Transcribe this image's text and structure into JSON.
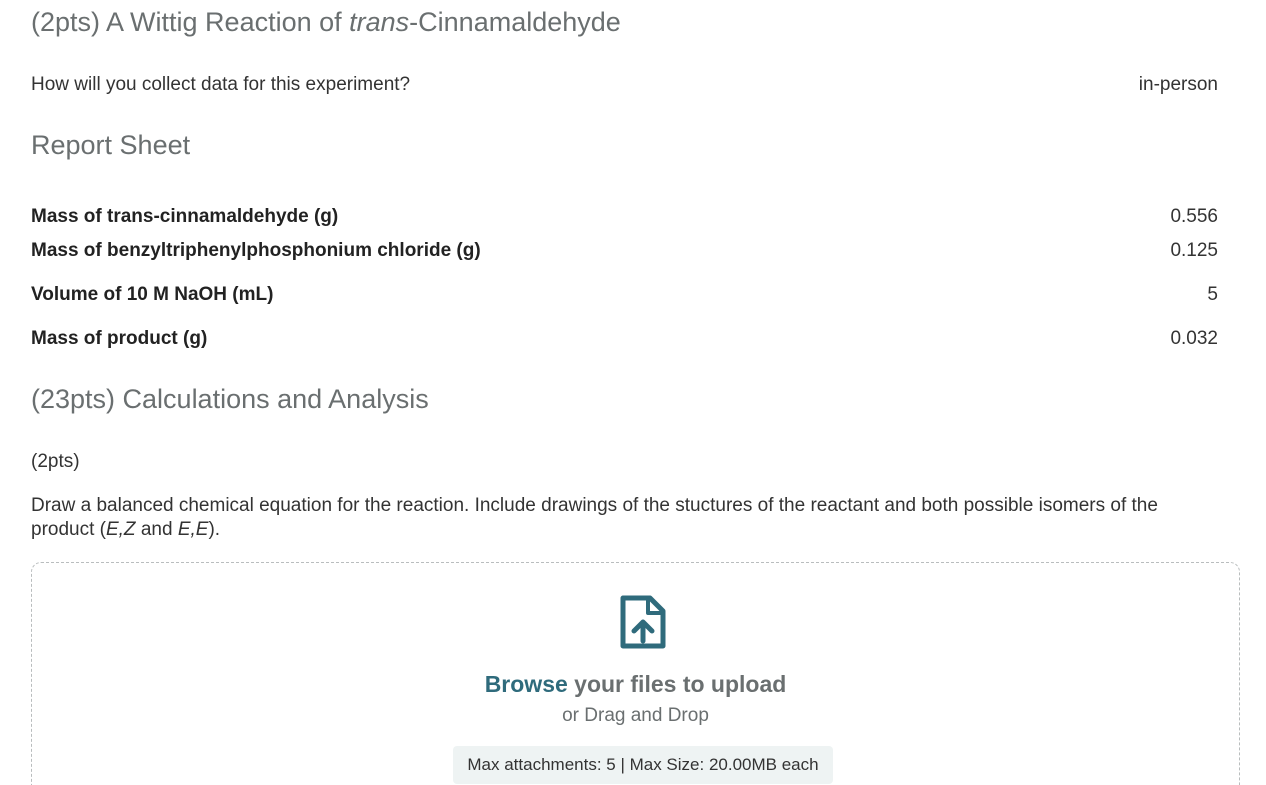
{
  "header": {
    "title_prefix": "(2pts) A Wittig Reaction of ",
    "title_italic": "trans",
    "title_suffix": "-Cinnamaldehyde"
  },
  "collection": {
    "question": "How will you collect data for this experiment?",
    "answer": "in-person"
  },
  "report_sheet": {
    "title": "Report Sheet",
    "rows": [
      {
        "label": "Mass of trans-cinnamaldehyde (g)",
        "value": "0.556"
      },
      {
        "label": "Mass of benzyltriphenylphosphonium chloride (g)",
        "value": "0.125"
      },
      {
        "label": "Volume of 10 M NaOH (mL)",
        "value": "5"
      },
      {
        "label": "Mass of product (g)",
        "value": "0.032"
      }
    ]
  },
  "calculations": {
    "title": "(23pts) Calculations and Analysis",
    "points": "(2pts)",
    "prompt_part1": "Draw a balanced chemical equation for the reaction. Include drawings of the stuctures of the reactant and both possible isomers of the product (",
    "prompt_italic1": "E,Z",
    "prompt_and": " and ",
    "prompt_italic2": "E,E",
    "prompt_end": ")."
  },
  "upload": {
    "icon": "file-upload-icon",
    "browse_label": "Browse",
    "title_rest": " your files to upload",
    "subtitle": "or Drag and Drop",
    "limits": "Max attachments: 5 | Max Size: 20.00MB each"
  },
  "colors": {
    "heading": "#6a6f70",
    "accent": "#2f6b7c",
    "limits_bg": "#eef3f3"
  }
}
